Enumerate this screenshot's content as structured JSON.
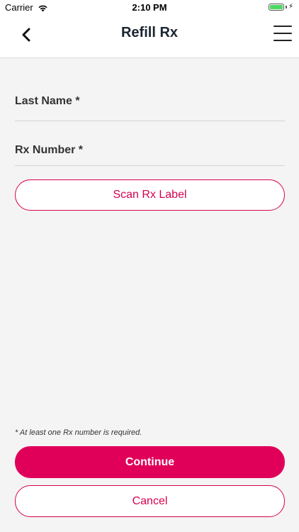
{
  "status_bar": {
    "carrier": "Carrier",
    "time": "2:10 PM",
    "battery_level": 1.0,
    "battery_color": "#4cd964"
  },
  "nav": {
    "title": "Refill Rx",
    "back_icon": "chevron-left-icon",
    "menu_icon": "hamburger-menu-icon"
  },
  "form": {
    "last_name_label": "Last Name *",
    "rx_number_label": "Rx Number *",
    "scan_button_label": "Scan Rx Label"
  },
  "footer": {
    "note": "* At least one Rx number is required.",
    "continue_label": "Continue",
    "cancel_label": "Cancel"
  },
  "colors": {
    "accent": "#e0005a",
    "background": "#f4f4f4"
  }
}
